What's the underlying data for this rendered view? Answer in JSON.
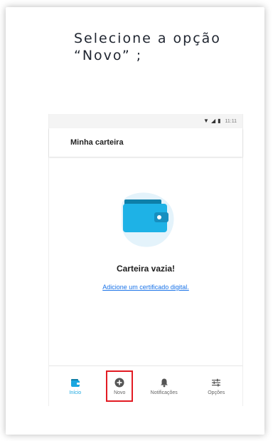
{
  "instruction": {
    "line1": "Selecione a opção",
    "line2": "“Novo” ;"
  },
  "statusbar": {
    "wifi_icon": "▼",
    "signal_icon": "◢",
    "battery_icon": "▮",
    "time": "11:11"
  },
  "appbar": {
    "title": "Minha carteira"
  },
  "empty_state": {
    "title": "Carteira vazia!",
    "link": "Adicione um certificado digital."
  },
  "bottom_nav": {
    "items": [
      {
        "label": "Início",
        "icon": "wallet-icon"
      },
      {
        "label": "Novo",
        "icon": "plus-circle-icon"
      },
      {
        "label": "Notificações",
        "icon": "bell-icon"
      },
      {
        "label": "Opções",
        "icon": "sliders-icon"
      }
    ]
  },
  "colors": {
    "accent": "#1aa7e0",
    "highlight": "#e21b23",
    "link": "#1a73e8"
  }
}
